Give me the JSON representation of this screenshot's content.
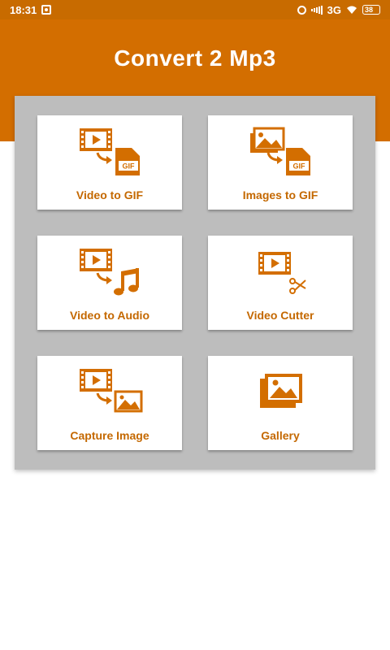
{
  "status_bar": {
    "time": "18:31",
    "network": "3G",
    "battery": "38"
  },
  "app": {
    "title": "Convert 2 Mp3",
    "accent_color": "#d36e00"
  },
  "tiles": [
    {
      "label": "Video to GIF",
      "icon": "video-to-gif-icon"
    },
    {
      "label": "Images to GIF",
      "icon": "images-to-gif-icon"
    },
    {
      "label": "Video to Audio",
      "icon": "video-to-audio-icon"
    },
    {
      "label": "Video Cutter",
      "icon": "video-cutter-icon"
    },
    {
      "label": "Capture Image",
      "icon": "capture-image-icon"
    },
    {
      "label": "Gallery",
      "icon": "gallery-icon"
    }
  ],
  "badges": {
    "gif": "GIF"
  }
}
